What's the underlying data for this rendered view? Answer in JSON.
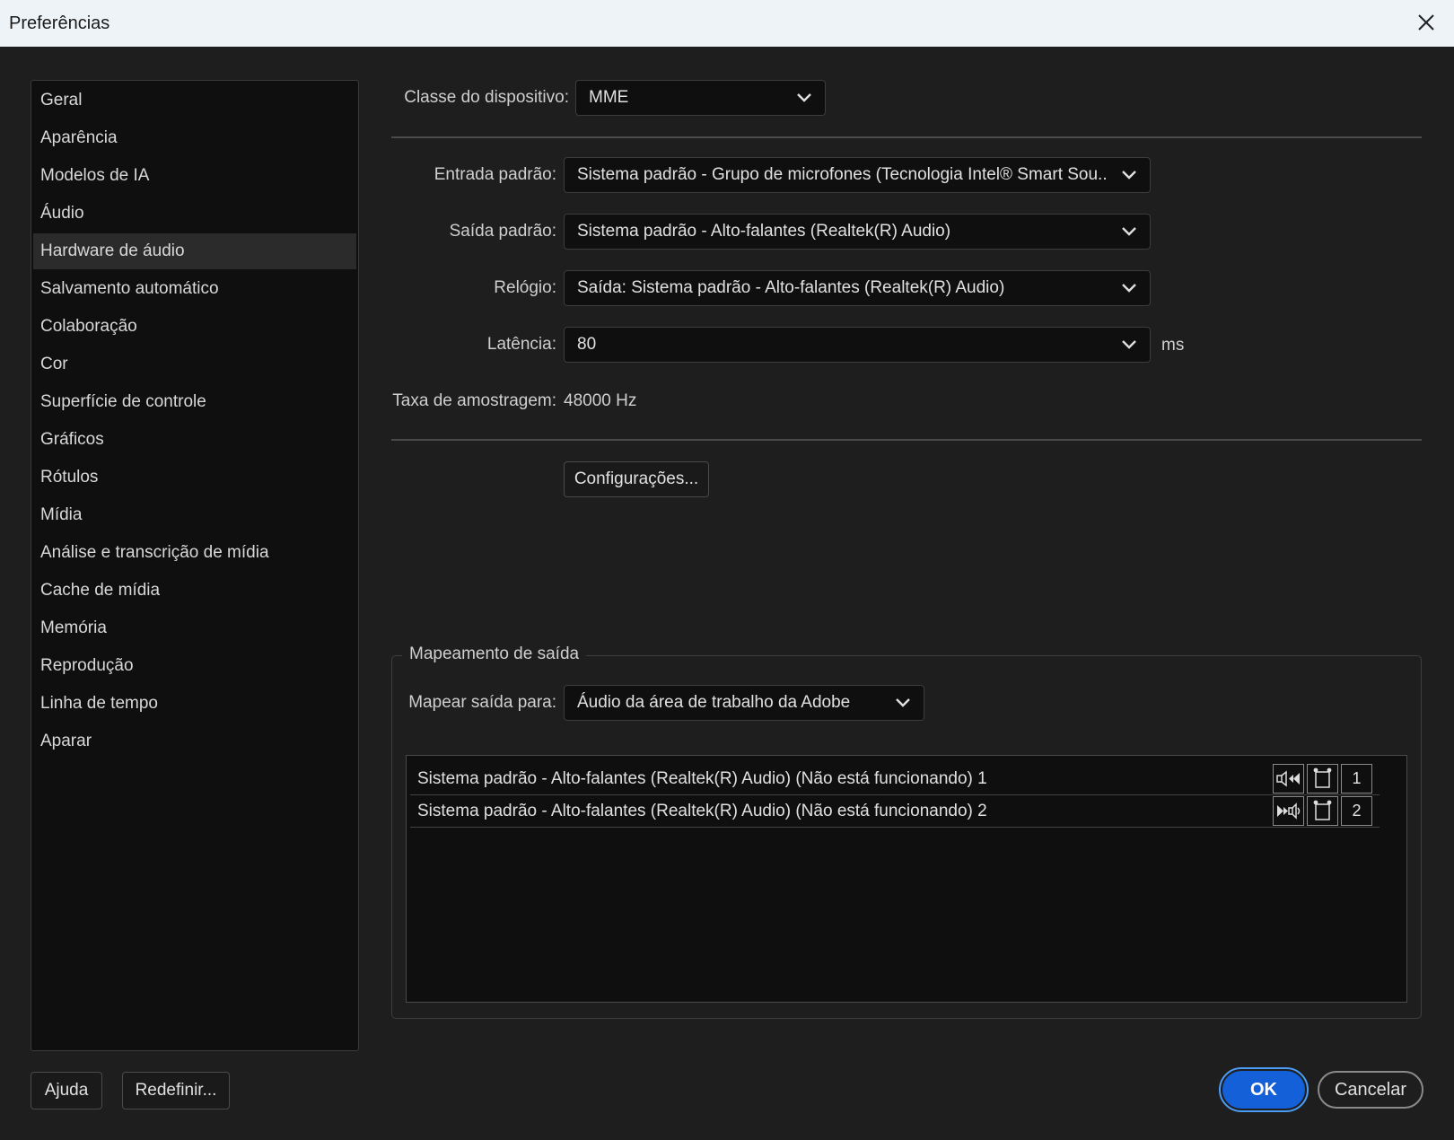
{
  "window": {
    "title": "Preferências"
  },
  "sidebar": {
    "items": [
      {
        "label": "Geral"
      },
      {
        "label": "Aparência"
      },
      {
        "label": "Modelos de IA"
      },
      {
        "label": "Áudio"
      },
      {
        "label": "Hardware de áudio",
        "selected": true
      },
      {
        "label": "Salvamento automático"
      },
      {
        "label": "Colaboração"
      },
      {
        "label": "Cor"
      },
      {
        "label": "Superfície de controle"
      },
      {
        "label": "Gráficos"
      },
      {
        "label": "Rótulos"
      },
      {
        "label": "Mídia"
      },
      {
        "label": "Análise e transcrição de mídia"
      },
      {
        "label": "Cache de mídia"
      },
      {
        "label": "Memória"
      },
      {
        "label": "Reprodução"
      },
      {
        "label": "Linha de tempo"
      },
      {
        "label": "Aparar"
      }
    ]
  },
  "device_class": {
    "label": "Classe do dispositivo:",
    "value": "MME"
  },
  "default_input": {
    "label": "Entrada padrão:",
    "value": "Sistema padrão - Grupo de microfones (Tecnologia Intel® Smart Sou..."
  },
  "default_output": {
    "label": "Saída padrão:",
    "value": "Sistema padrão - Alto-falantes (Realtek(R) Audio)"
  },
  "clock": {
    "label": "Relógio:",
    "value": "Saída: Sistema padrão - Alto-falantes (Realtek(R) Audio)"
  },
  "latency": {
    "label": "Latência:",
    "value": "80",
    "unit": "ms"
  },
  "sample_rate": {
    "label": "Taxa de amostragem:",
    "value": "48000 Hz"
  },
  "settings_button": "Configurações...",
  "output_mapping": {
    "title": "Mapeamento de saída",
    "map_label": "Mapear saída para:",
    "map_value": "Áudio da área de trabalho da Adobe",
    "rows": [
      {
        "text": "Sistema padrão - Alto-falantes (Realtek(R) Audio) (Não está funcionando) 1",
        "channel": "1",
        "speaker_icon": "speaker-left-icon"
      },
      {
        "text": "Sistema padrão - Alto-falantes (Realtek(R) Audio) (Não está funcionando) 2",
        "channel": "2",
        "speaker_icon": "speaker-right-icon"
      }
    ]
  },
  "footer": {
    "help": "Ajuda",
    "reset": "Redefinir...",
    "ok": "OK",
    "cancel": "Cancelar"
  },
  "colors": {
    "background": "#1e1e1e",
    "panel": "#0f0f0f",
    "accent": "#1460d8",
    "accent_border": "#4b9cf5",
    "titlebar": "#eef3f8"
  }
}
